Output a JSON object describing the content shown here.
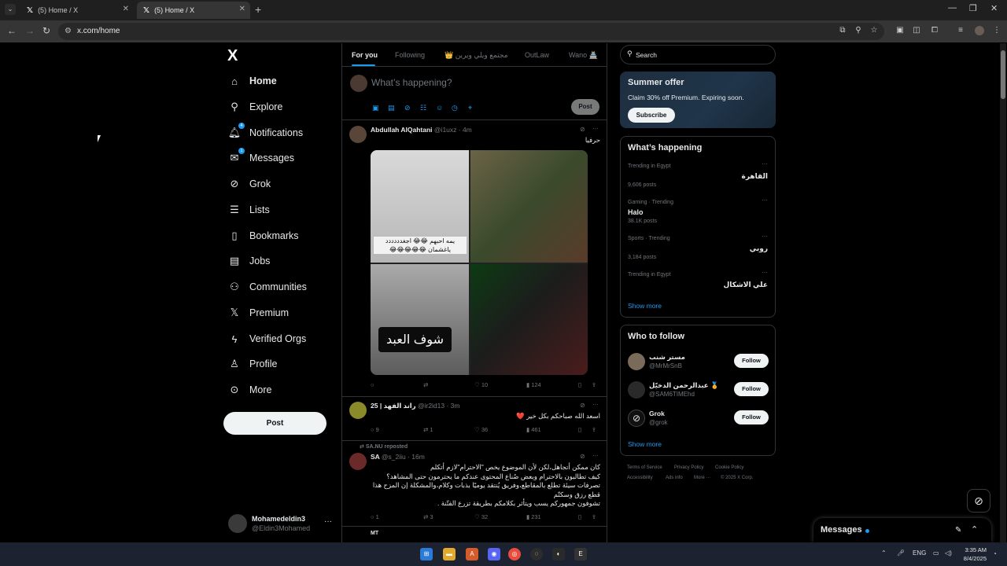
{
  "browser": {
    "tabs": [
      {
        "title": "(5) Home / X"
      },
      {
        "title": "(5) Home / X"
      }
    ],
    "url": "x.com/home"
  },
  "nav": {
    "logo": "X",
    "items": [
      {
        "label": "Home"
      },
      {
        "label": "Explore"
      },
      {
        "label": "Notifications",
        "badge": "4"
      },
      {
        "label": "Messages",
        "badge": "1"
      },
      {
        "label": "Grok"
      },
      {
        "label": "Lists"
      },
      {
        "label": "Bookmarks"
      },
      {
        "label": "Jobs"
      },
      {
        "label": "Communities"
      },
      {
        "label": "Premium"
      },
      {
        "label": "Verified Orgs"
      },
      {
        "label": "Profile"
      },
      {
        "label": "More"
      }
    ],
    "post_label": "Post",
    "account": {
      "name": "Mohamedeldin3",
      "handle": "@Eldin3Mohamed",
      "more": "···"
    }
  },
  "feed_tabs": [
    {
      "label": "For you"
    },
    {
      "label": "Following"
    },
    {
      "label": "مجتمع ويلي ويرين 👑"
    },
    {
      "label": "OutLaw"
    },
    {
      "label": "Wano 🏯"
    }
  ],
  "compose": {
    "placeholder": "What’s happening?",
    "post_label": "Post"
  },
  "tweets": [
    {
      "name": "Abdullah AlQahtani",
      "meta": "@i1uxz · 4m",
      "text": "حرفيا",
      "media_caption_1": "يمه احبهم 😂😂 اجغدددددد ياغشمان 😂😂😂😂😂",
      "media_caption_2": "شوف العبد",
      "reply": "",
      "repost": "",
      "like": "10",
      "views": "124"
    },
    {
      "name": "راند الفهد | 25",
      "meta": "@ir2id13 · 3m",
      "text": "اسعد الله صباحكم بكل خير ❤️",
      "reply": "9",
      "repost": "1",
      "like": "36",
      "views": "461"
    },
    {
      "reposted_by": "SA.NU reposted",
      "name": "SA",
      "meta": "@s_2iiu · 16m",
      "text_lines": [
        "كان ممكن أتجاهل،لكن لأن الموضوع يخص \"الاحترام\"لازم أتكلم",
        "كيف تطالبون بالاحترام وبعض صُناع المحتوى عندكم ما يحترمون حتى المشاهد؟",
        "تصرفات سيئة تطلع بالمقاطع،وفريق يُنتقد يوميًا بذبات وكلام،والمشكلة إن المزح هذا",
        "قطع رزق وسكتّم",
        "تشوفون جمهوركم يسب ويتأثر بكلامكم بطريقة تزرع الفتّنة ."
      ],
      "reply": "1",
      "repost": "3",
      "like": "32",
      "views": "231"
    },
    {
      "name": "MT",
      "meta": ""
    }
  ],
  "right": {
    "search_placeholder": "Search",
    "offer": {
      "title": "Summer offer",
      "text": "Claim 30% off Premium. Expiring soon.",
      "button": "Subscribe"
    },
    "trending": {
      "title": "What’s happening",
      "items": [
        {
          "context": "Trending in Egypt",
          "name": "القاهرة",
          "count": "9,606 posts",
          "rtl": true
        },
        {
          "context": "Gaming · Trending",
          "name": "Halo",
          "count": "38.1K posts",
          "rtl": false
        },
        {
          "context": "Sports · Trending",
          "name": "روبي",
          "count": "3,184 posts",
          "rtl": true
        },
        {
          "context": "Trending in Egypt",
          "name": "علي الاشكال",
          "count": "",
          "rtl": true
        }
      ],
      "show_more": "Show more"
    },
    "who_to_follow": {
      "title": "Who to follow",
      "items": [
        {
          "name": "مستر شنب",
          "handle": "@MrMrSnB",
          "button": "Follow"
        },
        {
          "name": "عبدالرحمن الدخيّل 🏅",
          "handle": "@SAM6TIMEhd",
          "button": "Follow"
        },
        {
          "name": "Grok",
          "handle": "@grok",
          "button": "Follow"
        }
      ],
      "show_more": "Show more"
    },
    "footer": [
      "Terms of Service",
      "Privacy Policy",
      "Cookie Policy",
      "Accessibility",
      "Ads info",
      "More ···",
      "© 2025 X Corp."
    ]
  },
  "messages_drawer": {
    "title": "Messages"
  },
  "taskbar": {
    "time": "3:35 AM",
    "date": "8/4/2025",
    "lang": "ENG"
  },
  "colors": {
    "accent": "#1d9bf0",
    "bg": "#000000",
    "border": "#2f3336",
    "muted": "#71767b"
  }
}
